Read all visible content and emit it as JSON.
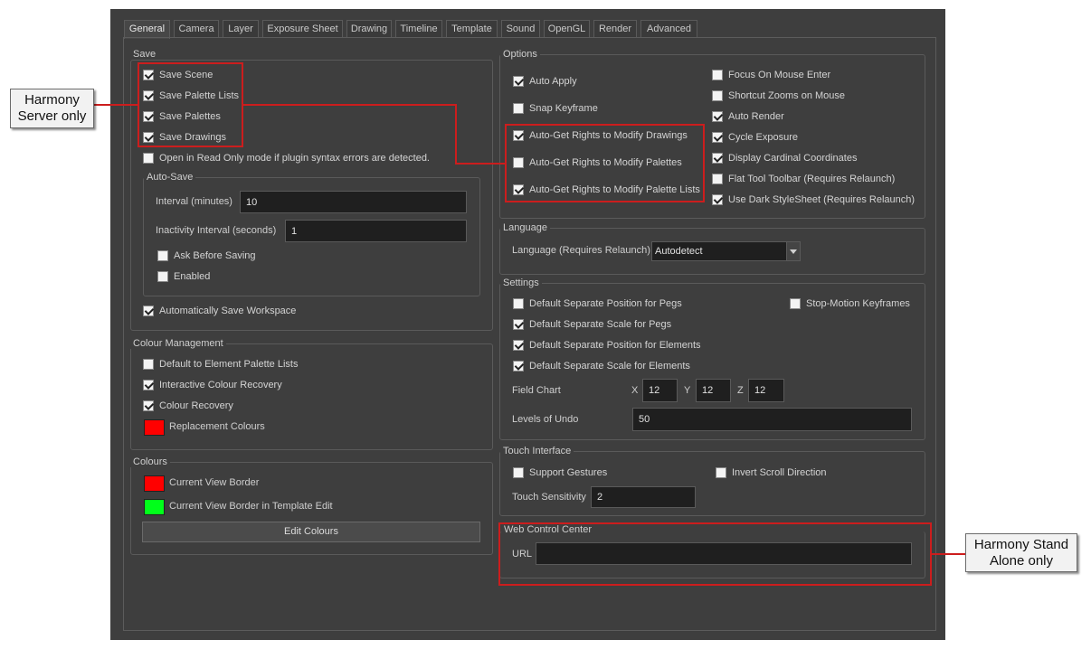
{
  "tabs": [
    "General",
    "Camera",
    "Layer",
    "Exposure Sheet",
    "Drawing",
    "Timeline",
    "Template",
    "Sound",
    "OpenGL",
    "Render",
    "Advanced"
  ],
  "save": {
    "title": "Save",
    "save_scene": "Save Scene",
    "save_palette_lists": "Save Palette Lists",
    "save_palettes": "Save Palettes",
    "save_drawings": "Save Drawings",
    "read_only": "Open in Read Only mode if plugin syntax errors are detected.",
    "autosave": {
      "title": "Auto-Save",
      "interval_label": "Interval (minutes)",
      "interval_value": "10",
      "inactivity_label": "Inactivity Interval (seconds)",
      "inactivity_value": "1",
      "ask_before": "Ask Before Saving",
      "enabled": "Enabled"
    },
    "auto_workspace": "Automatically Save Workspace"
  },
  "colour_mgmt": {
    "title": "Colour Management",
    "default_element": "Default to Element Palette Lists",
    "interactive_recovery": "Interactive Colour Recovery",
    "colour_recovery": "Colour Recovery",
    "replacement": "Replacement Colours"
  },
  "colours": {
    "title": "Colours",
    "view_border": "Current View Border",
    "view_border_template": "Current View Border in Template Edit",
    "edit_button": "Edit Colours"
  },
  "options": {
    "title": "Options",
    "auto_apply": "Auto Apply",
    "snap_keyframe": "Snap Keyframe",
    "rights_drawings": "Auto-Get Rights to Modify Drawings",
    "rights_palettes": "Auto-Get Rights to Modify Palettes",
    "rights_palette_lists": "Auto-Get Rights to Modify Palette Lists",
    "focus_mouse": "Focus On Mouse Enter",
    "shortcut_zooms": "Shortcut Zooms on Mouse",
    "auto_render": "Auto Render",
    "cycle_exposure": "Cycle Exposure",
    "cardinal": "Display Cardinal Coordinates",
    "flat_toolbar": "Flat Tool Toolbar (Requires Relaunch)",
    "dark_stylesheet": "Use Dark StyleSheet (Requires Relaunch)"
  },
  "language": {
    "title": "Language",
    "label": "Language (Requires Relaunch)",
    "value": "Autodetect"
  },
  "settings": {
    "title": "Settings",
    "sep_pos_pegs": "Default Separate Position for Pegs",
    "sep_scale_pegs": "Default Separate Scale for Pegs",
    "sep_pos_elements": "Default Separate Position for Elements",
    "sep_scale_elements": "Default Separate Scale for Elements",
    "stop_motion": "Stop-Motion Keyframes",
    "field_chart": "Field Chart",
    "x_label": "X",
    "x_value": "12",
    "y_label": "Y",
    "y_value": "12",
    "z_label": "Z",
    "z_value": "12",
    "undo_label": "Levels of Undo",
    "undo_value": "50"
  },
  "touch": {
    "title": "Touch Interface",
    "gestures": "Support Gestures",
    "invert_scroll": "Invert Scroll Direction",
    "sensitivity_label": "Touch Sensitivity",
    "sensitivity_value": "2"
  },
  "web": {
    "title": "Web Control Center",
    "url_label": "URL",
    "url_value": ""
  },
  "callouts": {
    "server_line1": "Harmony",
    "server_line2": "Server only",
    "standalone_line1": "Harmony Stand",
    "standalone_line2": "Alone only"
  },
  "colors": {
    "accent_red": "#cc1d1d",
    "swatch_red": "#ff0000",
    "swatch_green": "#00ff1a"
  }
}
